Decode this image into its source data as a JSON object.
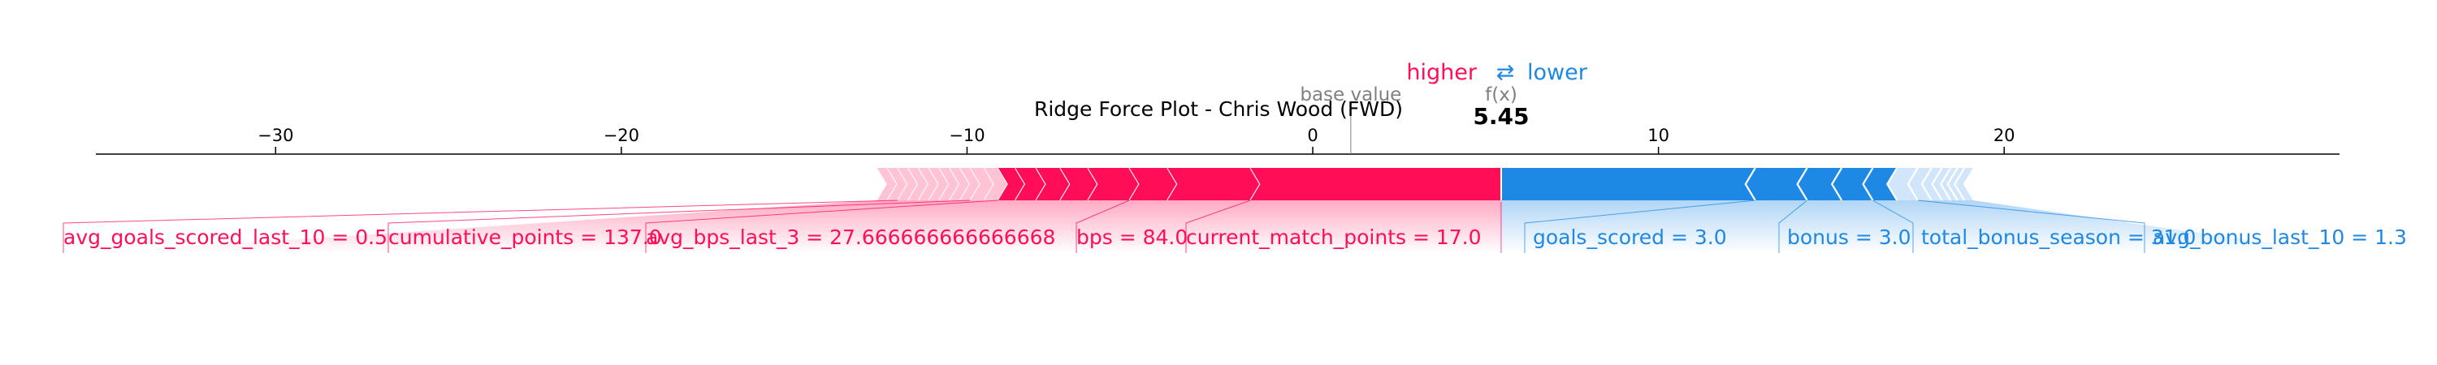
{
  "chart_data": {
    "type": "force",
    "title": "Ridge Force Plot - Chris Wood (FWD)",
    "xlim": [
      -35.2,
      29.7
    ],
    "ticks": [
      -30,
      -20,
      -10,
      0,
      10,
      20
    ],
    "base_value": 1.1,
    "output_value": 5.45,
    "output_label": "5.45",
    "base_value_label": "base value",
    "fx_label": "f(x)",
    "legend": {
      "higher": "higher",
      "lower": "lower",
      "arrow": "⇄"
    },
    "colors": {
      "positive": "#ff0d57",
      "negative": "#1e88e5",
      "positive_light": "#ffc3d5",
      "negative_light": "#d1e6fa",
      "axis": "#000000",
      "muted": "#808080"
    },
    "positive_start": -12.6,
    "negative_end": 19.1,
    "positive_boundaries": [
      -12.6,
      -12.3,
      -12.0,
      -11.7,
      -11.4,
      -11.1,
      -10.8,
      -10.5,
      -10.2,
      -9.9,
      -9.5,
      -9.1,
      -8.6,
      -8.0,
      -7.3,
      -6.5,
      -5.3,
      -4.2,
      -1.8,
      5.45
    ],
    "negative_boundaries": [
      5.45,
      12.8,
      14.3,
      15.3,
      16.2,
      16.9,
      17.5,
      17.9,
      18.2,
      18.45,
      18.65,
      18.85,
      19.1
    ],
    "positive_features": [
      {
        "label": "avg_goals_scored_last_10 = 0.5",
        "start": -12.0,
        "end": -11.7
      },
      {
        "label": "cumulative_points = 137.0",
        "start": -9.9,
        "end": -9.5
      },
      {
        "label": "avg_bps_last_3 = 27.666666666666668",
        "start": -9.1,
        "end": -8.6
      },
      {
        "label": "bps = 84.0",
        "start": -5.3,
        "end": -4.2
      },
      {
        "label": "current_match_points = 17.0",
        "start": -1.8,
        "end": 5.45
      }
    ],
    "negative_features": [
      {
        "label": "goals_scored = 3.0",
        "start": 5.45,
        "end": 12.8
      },
      {
        "label": "bonus = 3.0",
        "start": 12.8,
        "end": 14.3
      },
      {
        "label": "total_bonus_season = 31.0",
        "start": 15.3,
        "end": 16.2
      },
      {
        "label": "avg_bonus_last_10 = 1.3",
        "start": 16.9,
        "end": 17.5
      }
    ]
  }
}
